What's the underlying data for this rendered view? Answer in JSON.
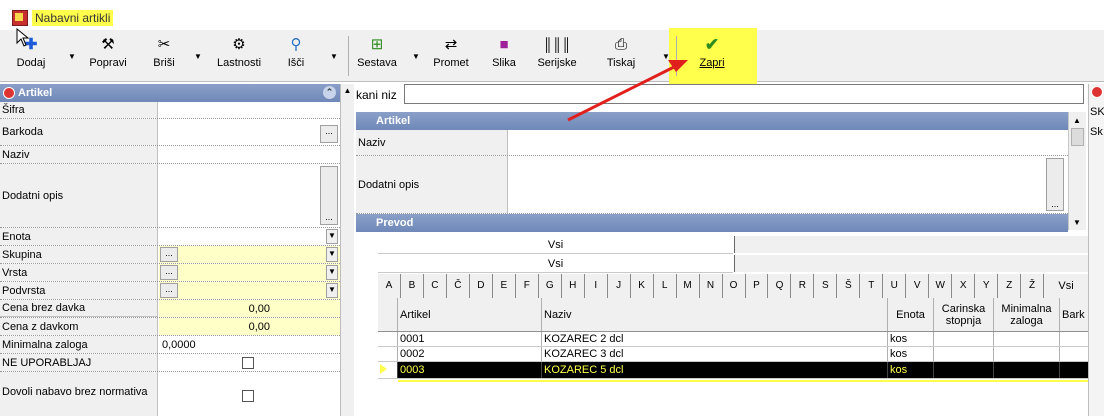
{
  "window": {
    "title": "Nabavni artikli"
  },
  "toolbar": {
    "dodaj": "Dodaj",
    "popravi": "Popravi",
    "brisi": "Briši",
    "lastnosti": "Lastnosti",
    "isci": "Išči",
    "sestava": "Sestava",
    "promet": "Promet",
    "slika": "Slika",
    "serijske": "Serijske",
    "tiskaj": "Tiskaj",
    "zapri": "Zapri"
  },
  "left_panel": {
    "title": "Artikel",
    "fields": {
      "sifra": "Šifra",
      "barkoda": "Barkoda",
      "naziv": "Naziv",
      "dodatni_opis": "Dodatni opis",
      "enota": "Enota",
      "skupina": "Skupina",
      "vrsta": "Vrsta",
      "podvrsta": "Podvrsta",
      "cena_brez_davka": "Cena brez davka",
      "cena_brez_davka_value": "0,00",
      "cena_z_davkom": "Cena z davkom",
      "cena_z_davkom_value": "0,00",
      "minimalna_zaloga": "Minimalna zaloga",
      "minimalna_zaloga_value": "0,0000",
      "ne_uporabljaj": "NE UPORABLJAJ",
      "dovoli_nabavo": "Dovoli nabavo brez normativa"
    }
  },
  "right_panel": {
    "search_label": "kani niz",
    "artikel_title": "Artikel",
    "naziv": "Naziv",
    "dodatni_opis": "Dodatni opis",
    "prevod_title": "Prevod",
    "lang_rows": [
      "Vsi",
      "Vsi"
    ],
    "letters": [
      "A",
      "B",
      "C",
      "Č",
      "D",
      "E",
      "F",
      "G",
      "H",
      "I",
      "J",
      "K",
      "L",
      "M",
      "N",
      "O",
      "P",
      "Q",
      "R",
      "S",
      "Š",
      "T",
      "U",
      "V",
      "W",
      "X",
      "Y",
      "Z",
      "Ž",
      "Vsi"
    ],
    "grid": {
      "columns": [
        "Artikel",
        "Naziv",
        "Enota",
        "Carinska stopnja",
        "Minimalna zaloga",
        "Bark"
      ],
      "rows": [
        {
          "artikel": "0001",
          "naziv": "KOZAREC 2 dcl",
          "enota": "kos"
        },
        {
          "artikel": "0002",
          "naziv": "KOZAREC 3 dcl",
          "enota": "kos"
        },
        {
          "artikel": "0003",
          "naziv": "KOZAREC 5 dcl",
          "enota": "kos"
        }
      ]
    }
  },
  "side_panel": {
    "items": [
      "SK",
      "Sk"
    ]
  },
  "colors": {
    "highlight": "#ffff4c",
    "header": "#7a92c0",
    "annotation_arrow": "#e0201c",
    "zapri_check": "#2e8b1e"
  }
}
